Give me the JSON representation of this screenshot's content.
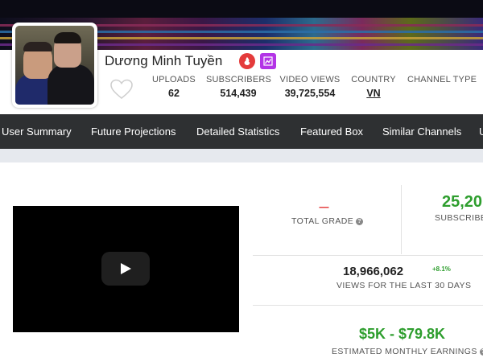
{
  "channel": {
    "name": "Dương Minh Tuyền",
    "favorite_icon": "heart-outline-icon",
    "badges": [
      "trending-icon",
      "partner-chart-icon"
    ]
  },
  "stats": [
    {
      "label": "UPLOADS",
      "value": "62"
    },
    {
      "label": "SUBSCRIBERS",
      "value": "514,439"
    },
    {
      "label": "VIDEO VIEWS",
      "value": "39,725,554"
    },
    {
      "label": "COUNTRY",
      "value": "VN"
    },
    {
      "label": "CHANNEL TYPE",
      "value": ""
    }
  ],
  "nav": {
    "items": [
      "User Summary",
      "Future Projections",
      "Detailed Statistics",
      "Featured Box",
      "Similar Channels",
      "U"
    ]
  },
  "summary": {
    "grade_value": "----",
    "grade_label": "TOTAL GRADE",
    "subscriber_rank_value": "25,20",
    "subscriber_rank_label": "SUBSCRIBE",
    "views_30d": "18,966,062",
    "views_30d_change": "+8.1%",
    "views_30d_label": "VIEWS FOR THE LAST 30 DAYS",
    "earnings": "$5K - $79.8K",
    "earnings_label": "ESTIMATED MONTHLY EARNINGS"
  },
  "colors": {
    "nav_bg": "#2e3032",
    "accent_green": "#2e9e2e",
    "grade_red": "#e43b3b",
    "badge_purple": "#b334e6"
  }
}
